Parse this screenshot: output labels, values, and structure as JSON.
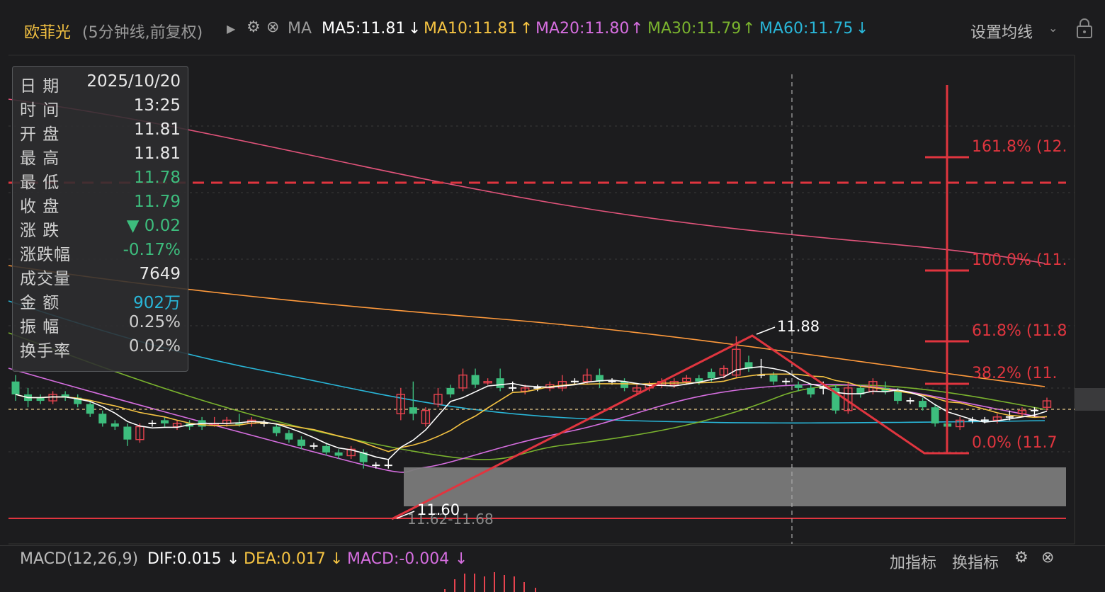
{
  "header": {
    "stock_name": "欧菲光",
    "period_label": "(5分钟线,前复权)",
    "ma_label": "MA",
    "ma5": "MA5:11.81",
    "ma5_arrow": "↓",
    "ma10": "MA10:11.81",
    "ma10_arrow": "↑",
    "ma20": "MA20:11.80",
    "ma20_arrow": "↑",
    "ma30": "MA30:11.79",
    "ma30_arrow": "↑",
    "ma60": "MA60:11.75",
    "ma60_arrow": "↓",
    "settings_label": "设置均线"
  },
  "info": [
    {
      "label": "日  期",
      "value": "2025/10/20",
      "color": "#e8e8e8"
    },
    {
      "label": "时  间",
      "value": "13:25",
      "color": "#e8e8e8"
    },
    {
      "label": "开  盘",
      "value": "11.81",
      "color": "#e8e8e8"
    },
    {
      "label": "最  高",
      "value": "11.81",
      "color": "#e8e8e8"
    },
    {
      "label": "最  低",
      "value": "11.78",
      "color": "#3dbd7d"
    },
    {
      "label": "收  盘",
      "value": "11.79",
      "color": "#3dbd7d"
    },
    {
      "label": "涨  跌",
      "value": "▼ 0.02",
      "color": "#3dbd7d"
    },
    {
      "label": "涨跌幅",
      "value": "-0.17%",
      "color": "#3dbd7d"
    },
    {
      "label": "成交量",
      "value": "7649",
      "color": "#e8e8e8"
    },
    {
      "label": "金  额",
      "value": "902万",
      "color": "#29b6d8"
    },
    {
      "label": "振  幅",
      "value": "0.25%",
      "color": "#cfcfcf"
    },
    {
      "label": "换手率",
      "value": "0.02%",
      "color": "#cfcfcf"
    }
  ],
  "annotations": {
    "high_label": "11.88",
    "low_label": "11.60",
    "range_label": "11.62-11.68",
    "fib": [
      "161.8% (12.",
      "100.0% (11.",
      "61.8%  (11.8",
      "38.2%  (11.",
      "0.0%  (11.7"
    ]
  },
  "macd": {
    "title": "MACD(12,26,9)",
    "dif": "DIF:0.015",
    "dif_arrow": "↓",
    "dea": "DEA:0.017",
    "dea_arrow": "↓",
    "macd": "MACD:-0.004",
    "macd_arrow": "↓",
    "add_label": "加指标",
    "switch_label": "换指标"
  },
  "colors": {
    "up": "#e8434f",
    "down": "#3dbd7d",
    "ma5": "#ffffff",
    "ma10": "#f5c342",
    "ma20": "#d66ee0",
    "ma30": "#7ab32e",
    "ma60": "#29b6d8",
    "ma_long1": "#ff9a3c",
    "ma_long2": "#e0537a",
    "draw": "#e0353f"
  },
  "chart_data": {
    "type": "candlestick",
    "title": "欧菲光 (5分钟线,前复权)",
    "candles": [
      {
        "o": 11.81,
        "c": 11.79,
        "h": 11.82,
        "l": 11.78,
        "s": "d"
      },
      {
        "o": 11.79,
        "c": 11.78,
        "h": 11.8,
        "l": 11.77,
        "s": "d"
      },
      {
        "o": 11.78,
        "c": 11.785,
        "h": 11.79,
        "l": 11.775,
        "s": "d"
      },
      {
        "o": 11.78,
        "c": 11.79,
        "h": 11.795,
        "l": 11.775,
        "s": "u"
      },
      {
        "o": 11.79,
        "c": 11.785,
        "h": 11.795,
        "l": 11.78,
        "s": "d"
      },
      {
        "o": 11.785,
        "c": 11.775,
        "h": 11.79,
        "l": 11.77,
        "s": "d"
      },
      {
        "o": 11.775,
        "c": 11.76,
        "h": 11.78,
        "l": 11.755,
        "s": "d"
      },
      {
        "o": 11.76,
        "c": 11.745,
        "h": 11.765,
        "l": 11.74,
        "s": "d"
      },
      {
        "o": 11.745,
        "c": 11.74,
        "h": 11.75,
        "l": 11.735,
        "s": "d"
      },
      {
        "o": 11.74,
        "c": 11.72,
        "h": 11.745,
        "l": 11.71,
        "s": "d"
      },
      {
        "o": 11.72,
        "c": 11.74,
        "h": 11.745,
        "l": 11.715,
        "s": "u"
      },
      {
        "o": 11.745,
        "c": 11.745,
        "h": 11.75,
        "l": 11.74,
        "s": "x"
      },
      {
        "o": 11.745,
        "c": 11.75,
        "h": 11.755,
        "l": 11.74,
        "s": "d"
      },
      {
        "o": 11.745,
        "c": 11.74,
        "h": 11.75,
        "l": 11.735,
        "s": "u"
      },
      {
        "o": 11.745,
        "c": 11.74,
        "h": 11.75,
        "l": 11.735,
        "s": "d"
      },
      {
        "o": 11.74,
        "c": 11.75,
        "h": 11.755,
        "l": 11.735,
        "s": "d"
      },
      {
        "o": 11.745,
        "c": 11.745,
        "h": 11.755,
        "l": 11.74,
        "s": "u"
      },
      {
        "o": 11.745,
        "c": 11.75,
        "h": 11.755,
        "l": 11.74,
        "s": "u"
      },
      {
        "o": 11.745,
        "c": 11.745,
        "h": 11.76,
        "l": 11.74,
        "s": "d"
      },
      {
        "o": 11.745,
        "c": 11.75,
        "h": 11.755,
        "l": 11.74,
        "s": "u"
      },
      {
        "o": 11.745,
        "c": 11.745,
        "h": 11.75,
        "l": 11.74,
        "s": "x"
      },
      {
        "o": 11.74,
        "c": 11.73,
        "h": 11.745,
        "l": 11.725,
        "s": "d"
      },
      {
        "o": 11.73,
        "c": 11.72,
        "h": 11.735,
        "l": 11.715,
        "s": "d"
      },
      {
        "o": 11.72,
        "c": 11.71,
        "h": 11.725,
        "l": 11.705,
        "s": "d"
      },
      {
        "o": 11.71,
        "c": 11.71,
        "h": 11.715,
        "l": 11.705,
        "s": "x"
      },
      {
        "o": 11.71,
        "c": 11.7,
        "h": 11.715,
        "l": 11.695,
        "s": "d"
      },
      {
        "o": 11.7,
        "c": 11.695,
        "h": 11.705,
        "l": 11.69,
        "s": "d"
      },
      {
        "o": 11.695,
        "c": 11.705,
        "h": 11.71,
        "l": 11.69,
        "s": "u"
      },
      {
        "o": 11.7,
        "c": 11.685,
        "h": 11.705,
        "l": 11.675,
        "s": "d"
      },
      {
        "o": 11.68,
        "c": 11.68,
        "h": 11.685,
        "l": 11.675,
        "s": "x"
      },
      {
        "o": 11.68,
        "c": 11.68,
        "h": 11.69,
        "l": 11.675,
        "s": "x"
      },
      {
        "o": 11.76,
        "c": 11.79,
        "h": 11.8,
        "l": 11.75,
        "s": "u"
      },
      {
        "o": 11.77,
        "c": 11.76,
        "h": 11.81,
        "l": 11.75,
        "s": "d"
      },
      {
        "o": 11.745,
        "c": 11.765,
        "h": 11.77,
        "l": 11.74,
        "s": "u"
      },
      {
        "o": 11.775,
        "c": 11.79,
        "h": 11.8,
        "l": 11.77,
        "s": "u"
      },
      {
        "o": 11.8,
        "c": 11.79,
        "h": 11.805,
        "l": 11.785,
        "s": "d"
      },
      {
        "o": 11.8,
        "c": 11.82,
        "h": 11.83,
        "l": 11.795,
        "s": "u"
      },
      {
        "o": 11.82,
        "c": 11.805,
        "h": 11.83,
        "l": 11.8,
        "s": "d"
      },
      {
        "o": 11.81,
        "c": 11.81,
        "h": 11.815,
        "l": 11.805,
        "s": "u"
      },
      {
        "o": 11.815,
        "c": 11.8,
        "h": 11.83,
        "l": 11.795,
        "s": "d"
      },
      {
        "o": 11.805,
        "c": 11.8,
        "h": 11.81,
        "l": 11.795,
        "s": "x"
      },
      {
        "o": 11.795,
        "c": 11.8,
        "h": 11.805,
        "l": 11.79,
        "s": "u"
      },
      {
        "o": 11.8,
        "c": 11.8,
        "h": 11.805,
        "l": 11.795,
        "s": "x"
      },
      {
        "o": 11.8,
        "c": 11.805,
        "h": 11.81,
        "l": 11.795,
        "s": "u"
      },
      {
        "o": 11.8,
        "c": 11.81,
        "h": 11.82,
        "l": 11.795,
        "s": "u"
      },
      {
        "o": 11.81,
        "c": 11.81,
        "h": 11.815,
        "l": 11.805,
        "s": "x"
      },
      {
        "o": 11.81,
        "c": 11.82,
        "h": 11.83,
        "l": 11.805,
        "s": "u"
      },
      {
        "o": 11.82,
        "c": 11.81,
        "h": 11.83,
        "l": 11.8,
        "s": "d"
      },
      {
        "o": 11.81,
        "c": 11.81,
        "h": 11.815,
        "l": 11.805,
        "s": "x"
      },
      {
        "o": 11.81,
        "c": 11.8,
        "h": 11.815,
        "l": 11.795,
        "s": "d"
      },
      {
        "o": 11.8,
        "c": 11.795,
        "h": 11.805,
        "l": 11.79,
        "s": "u"
      },
      {
        "o": 11.8,
        "c": 11.805,
        "h": 11.81,
        "l": 11.795,
        "s": "u"
      },
      {
        "o": 11.805,
        "c": 11.81,
        "h": 11.815,
        "l": 11.8,
        "s": "u"
      },
      {
        "o": 11.81,
        "c": 11.805,
        "h": 11.815,
        "l": 11.8,
        "s": "u"
      },
      {
        "o": 11.81,
        "c": 11.815,
        "h": 11.82,
        "l": 11.805,
        "s": "u"
      },
      {
        "o": 11.815,
        "c": 11.81,
        "h": 11.82,
        "l": 11.805,
        "s": "d"
      },
      {
        "o": 11.815,
        "c": 11.825,
        "h": 11.83,
        "l": 11.81,
        "s": "d"
      },
      {
        "o": 11.82,
        "c": 11.83,
        "h": 11.835,
        "l": 11.815,
        "s": "u"
      },
      {
        "o": 11.82,
        "c": 11.86,
        "h": 11.88,
        "l": 11.815,
        "s": "u"
      },
      {
        "o": 11.84,
        "c": 11.83,
        "h": 11.85,
        "l": 11.825,
        "s": "d"
      },
      {
        "o": 11.825,
        "c": 11.82,
        "h": 11.845,
        "l": 11.815,
        "s": "x"
      },
      {
        "o": 11.82,
        "c": 11.81,
        "h": 11.825,
        "l": 11.805,
        "s": "d"
      },
      {
        "o": 11.81,
        "c": 11.81,
        "h": 11.815,
        "l": 11.805,
        "s": "x"
      },
      {
        "o": 11.805,
        "c": 11.8,
        "h": 11.81,
        "l": 11.795,
        "s": "d"
      },
      {
        "o": 11.8,
        "c": 11.79,
        "h": 11.805,
        "l": 11.785,
        "s": "d"
      },
      {
        "o": 11.795,
        "c": 11.8,
        "h": 11.81,
        "l": 11.79,
        "s": "x"
      },
      {
        "o": 11.8,
        "c": 11.765,
        "h": 11.805,
        "l": 11.76,
        "s": "d"
      },
      {
        "o": 11.765,
        "c": 11.8,
        "h": 11.81,
        "l": 11.76,
        "s": "u"
      },
      {
        "o": 11.79,
        "c": 11.8,
        "h": 11.805,
        "l": 11.785,
        "s": "d"
      },
      {
        "o": 11.795,
        "c": 11.81,
        "h": 11.815,
        "l": 11.79,
        "s": "u"
      },
      {
        "o": 11.8,
        "c": 11.795,
        "h": 11.81,
        "l": 11.79,
        "s": "d"
      },
      {
        "o": 11.795,
        "c": 11.78,
        "h": 11.8,
        "l": 11.775,
        "s": "d"
      },
      {
        "o": 11.78,
        "c": 11.78,
        "h": 11.785,
        "l": 11.775,
        "s": "x"
      },
      {
        "o": 11.78,
        "c": 11.77,
        "h": 11.785,
        "l": 11.765,
        "s": "d"
      },
      {
        "o": 11.77,
        "c": 11.745,
        "h": 11.775,
        "l": 11.74,
        "s": "d"
      },
      {
        "o": 11.745,
        "c": 11.74,
        "h": 11.75,
        "l": 11.735,
        "s": "d"
      },
      {
        "o": 11.74,
        "c": 11.75,
        "h": 11.755,
        "l": 11.735,
        "s": "u"
      },
      {
        "o": 11.75,
        "c": 11.75,
        "h": 11.755,
        "l": 11.745,
        "s": "x"
      },
      {
        "o": 11.75,
        "c": 11.75,
        "h": 11.755,
        "l": 11.745,
        "s": "x"
      },
      {
        "o": 11.75,
        "c": 11.755,
        "h": 11.76,
        "l": 11.745,
        "s": "u"
      },
      {
        "o": 11.755,
        "c": 11.755,
        "h": 11.765,
        "l": 11.75,
        "s": "x"
      },
      {
        "o": 11.76,
        "c": 11.765,
        "h": 11.77,
        "l": 11.755,
        "s": "u"
      },
      {
        "o": 11.76,
        "c": 11.765,
        "h": 11.77,
        "l": 11.755,
        "s": "x"
      },
      {
        "o": 11.77,
        "c": 11.78,
        "h": 11.785,
        "l": 11.765,
        "s": "u"
      }
    ],
    "price_axis": {
      "min": 11.6,
      "max": 11.88
    },
    "levels": {
      "dashed_resistance": 11.93,
      "low_line": 11.6,
      "dotted_current": 11.8
    },
    "annotations": {
      "high": 11.88,
      "low": 11.6,
      "box_range": [
        11.62,
        11.68
      ]
    },
    "fibonacci": {
      "base": 11.74,
      "top": 11.88,
      "levels": [
        "161.8%",
        "100.0%",
        "61.8%",
        "38.2%",
        "0.0%"
      ]
    }
  }
}
